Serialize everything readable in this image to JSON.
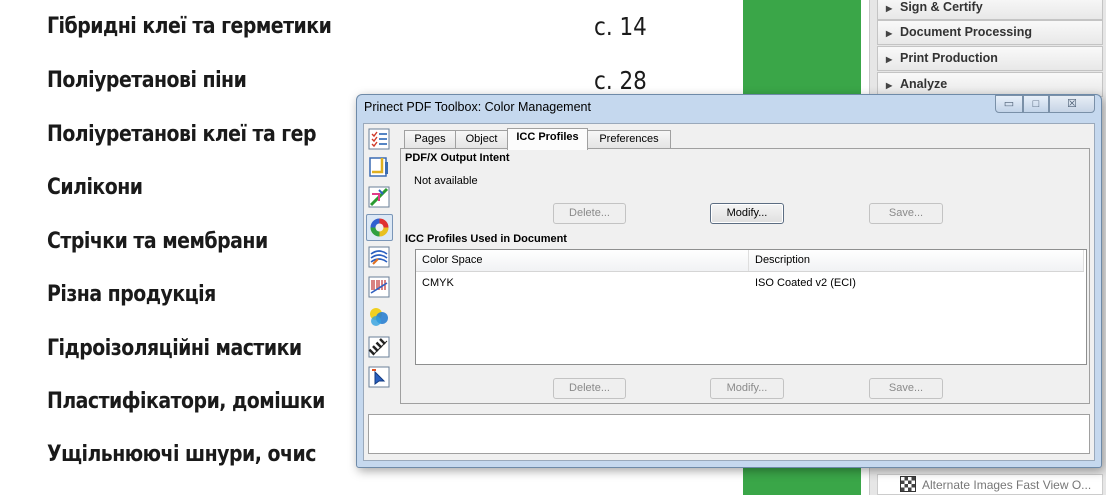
{
  "document": {
    "toc": [
      {
        "label": "Гібридні клеї та герметики",
        "page": "с. 14"
      },
      {
        "label": "Поліуретанові піни",
        "page": "с. 28"
      },
      {
        "label": "Поліуретанові клеї та гер",
        "page": ""
      },
      {
        "label": "Силікони",
        "page": ""
      },
      {
        "label": "Стрічки та мембрани",
        "page": ""
      },
      {
        "label": "Різна продукція",
        "page": ""
      },
      {
        "label": "Гідроізоляційні мастики",
        "page": ""
      },
      {
        "label": "Пластифікатори, домішки",
        "page": ""
      },
      {
        "label": "Ущільнюючі шнури, очис",
        "page": ""
      }
    ]
  },
  "tools_panel": {
    "items": [
      "Sign & Certify",
      "Document Processing",
      "Print Production",
      "Analyze"
    ],
    "bottom_item": "Alternate Images Fast View O..."
  },
  "dialog": {
    "title": "Prinect PDF Toolbox: Color Management",
    "controls": {
      "minimize": "▭",
      "maximize": "□",
      "close": "☒"
    },
    "tabs": [
      "Pages",
      "Object",
      "ICC Profiles",
      "Preferences"
    ],
    "active_tab": "ICC Profiles",
    "output_intent": {
      "heading": "PDF/X Output Intent",
      "status": "Not available",
      "buttons": {
        "delete": "Delete...",
        "modify": "Modify...",
        "save": "Save..."
      }
    },
    "profiles": {
      "heading": "ICC Profiles Used in Document",
      "columns": [
        "Color Space",
        "Description"
      ],
      "rows": [
        {
          "color_space": "CMYK",
          "description": "ISO Coated v2 (ECI)"
        }
      ],
      "buttons": {
        "delete": "Delete...",
        "modify": "Modify...",
        "save": "Save..."
      }
    },
    "sidebar_icons": [
      "checklist-icon",
      "page-box-icon",
      "transform-icon",
      "color-wheel-icon",
      "wave-lines-icon",
      "barcode-icon",
      "color-circles-icon",
      "checker-flag-icon",
      "cursor-icon"
    ]
  }
}
